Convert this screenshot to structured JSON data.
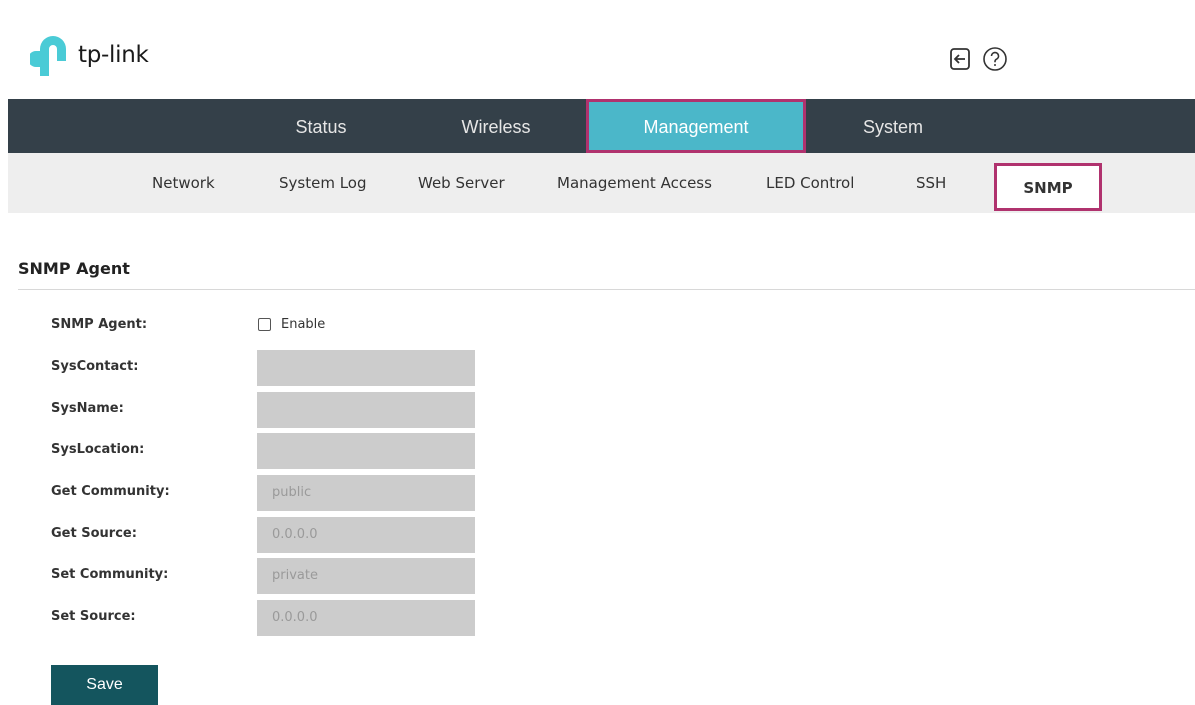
{
  "brand": {
    "name": "tp-link"
  },
  "header": {
    "logout_icon": "logout-icon",
    "help_icon": "help-icon"
  },
  "main_nav": [
    {
      "label": "Status",
      "active": false
    },
    {
      "label": "Wireless",
      "active": false
    },
    {
      "label": "Management",
      "active": true
    },
    {
      "label": "System",
      "active": false
    }
  ],
  "sub_nav": [
    {
      "label": "Network",
      "active": false
    },
    {
      "label": "System Log",
      "active": false
    },
    {
      "label": "Web Server",
      "active": false
    },
    {
      "label": "Management Access",
      "active": false
    },
    {
      "label": "LED Control",
      "active": false
    },
    {
      "label": "SSH",
      "active": false
    },
    {
      "label": "SNMP",
      "active": true
    }
  ],
  "section": {
    "title": "SNMP Agent",
    "fields": {
      "snmp_agent": {
        "label": "SNMP Agent:",
        "checkbox_label": "Enable",
        "checked": false
      },
      "sys_contact": {
        "label": "SysContact:",
        "value": ""
      },
      "sys_name": {
        "label": "SysName:",
        "value": ""
      },
      "sys_location": {
        "label": "SysLocation:",
        "value": ""
      },
      "get_community": {
        "label": "Get Community:",
        "value": "public"
      },
      "get_source": {
        "label": "Get Source:",
        "value": "0.0.0.0"
      },
      "set_community": {
        "label": "Set Community:",
        "value": "private"
      },
      "set_source": {
        "label": "Set Source:",
        "value": "0.0.0.0"
      }
    },
    "save_label": "Save"
  },
  "colors": {
    "nav_bg": "#344049",
    "active_tab": "#4bb7c9",
    "highlight_border": "#b0326e",
    "subnav_bg": "#eeeeee",
    "save_button": "#14555e",
    "brand_blue": "#4acbd6"
  }
}
